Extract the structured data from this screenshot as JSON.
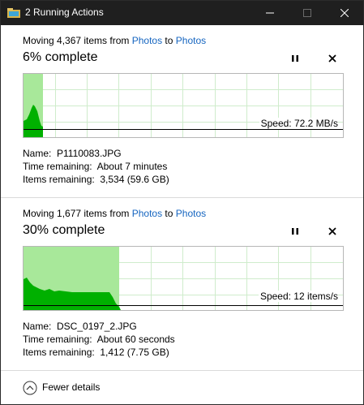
{
  "window": {
    "title": "2 Running Actions"
  },
  "operations": [
    {
      "moving_prefix": "Moving 4,367 items from ",
      "from": "Photos",
      "to_word": " to ",
      "to": "Photos",
      "percent_label": "6% complete",
      "progress": 0.06,
      "speed": "Speed: 72.2 MB/s",
      "name_label": "Name:",
      "name": "P1110083.JPG",
      "time_label": "Time remaining:",
      "time": "About 7 minutes",
      "items_label": "Items remaining:",
      "items": "3,534 (59.6 GB)"
    },
    {
      "moving_prefix": "Moving 1,677 items from ",
      "from": "Photos",
      "to_word": " to ",
      "to": "Photos",
      "percent_label": "30% complete",
      "progress": 0.3,
      "speed": "Speed: 12 items/s",
      "name_label": "Name:",
      "name": "DSC_0197_2.JPG",
      "time_label": "Time remaining:",
      "time": "About 60 seconds",
      "items_label": "Items remaining:",
      "items": "1,412 (7.75 GB)"
    }
  ],
  "footer": {
    "fewer_details": "Fewer details"
  },
  "icons": {
    "minimize": "minimize-icon",
    "maximize": "maximize-icon",
    "close": "close-icon",
    "pause": "pause-icon",
    "cancel": "cancel-icon",
    "chevron": "chevron-up-circle-icon"
  },
  "colors": {
    "titlebar": "#1f1f1f",
    "progress_fill": "#a8e89a",
    "speed_area": "#00b000",
    "grid": "#cfeccc",
    "link": "#1565c0"
  }
}
